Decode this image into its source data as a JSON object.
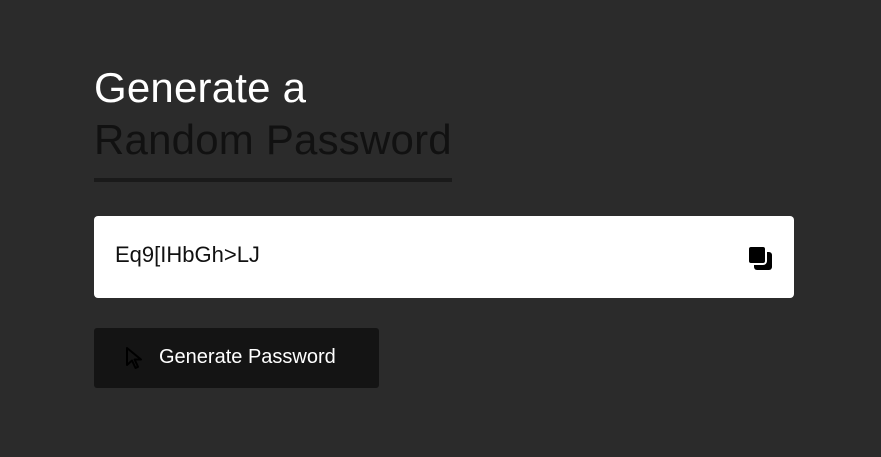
{
  "heading": {
    "line1": "Generate a",
    "line2": "Random Password"
  },
  "password": {
    "value": "Eq9[IHbGh>LJ",
    "copy_icon": "copy-icon"
  },
  "generate_button": {
    "label": "Generate Password",
    "icon": "cursor-pointer-icon"
  },
  "colors": {
    "background": "#2b2b2b",
    "heading_primary": "#ffffff",
    "heading_secondary": "#111111",
    "input_background": "#ffffff",
    "button_background": "#141414"
  }
}
